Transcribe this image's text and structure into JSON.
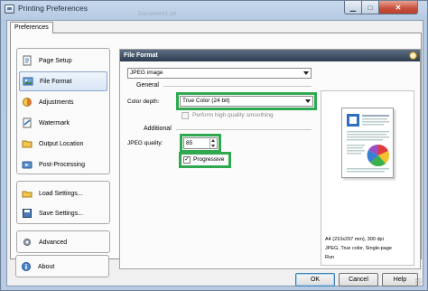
{
  "window": {
    "title": "Printing Preferences",
    "background_fragment": "Document1.txt"
  },
  "tabs": [
    {
      "label": "Preferences"
    }
  ],
  "sidebar": {
    "groups": [
      {
        "items": [
          {
            "label": "Page Setup",
            "icon": "page-setup-icon"
          },
          {
            "label": "File Format",
            "icon": "file-format-icon",
            "selected": true
          },
          {
            "label": "Adjustments",
            "icon": "adjustments-icon"
          },
          {
            "label": "Watermark",
            "icon": "watermark-icon"
          },
          {
            "label": "Output Location",
            "icon": "output-location-icon"
          },
          {
            "label": "Post-Processing",
            "icon": "post-processing-icon"
          }
        ]
      },
      {
        "items": [
          {
            "label": "Load Settings...",
            "icon": "load-settings-icon"
          },
          {
            "label": "Save Settings...",
            "icon": "save-settings-icon"
          }
        ]
      },
      {
        "items": [
          {
            "label": "Advanced",
            "icon": "advanced-icon"
          }
        ]
      },
      {
        "items": [
          {
            "label": "About",
            "icon": "about-icon"
          }
        ]
      }
    ]
  },
  "content": {
    "header": "File Format",
    "format_select": {
      "value": "JPEG image"
    },
    "general": {
      "label": "General",
      "color_depth_label": "Color depth:",
      "color_depth_value": "True Color (24 bit)",
      "smoothing_label": "Perform high quality smoothing",
      "smoothing_checked": false,
      "smoothing_enabled": false
    },
    "additional": {
      "label": "Additional",
      "jpeg_quality_label": "JPEG quality:",
      "jpeg_quality_value": "85",
      "progressive_label": "Progressive",
      "progressive_checked": true
    },
    "preview": {
      "lines": [
        "A4 (210x297 mm), 300 dpi",
        "JPEG, True color, Single-page",
        "Run"
      ]
    }
  },
  "footer": {
    "ok_label": "OK",
    "cancel_label": "Cancel",
    "help_label": "Help"
  },
  "colors": {
    "highlight": "#2fa84f",
    "header_bg": "#3b4a5e",
    "window_frame": "#b8cbe3"
  }
}
